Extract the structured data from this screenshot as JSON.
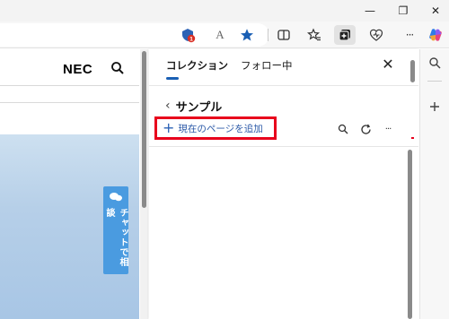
{
  "window": {
    "minimize_glyph": "—",
    "restore_glyph": "❐",
    "close_glyph": "✕"
  },
  "toolbar": {
    "icons": [
      "extension-alert-icon",
      "read-aloud-icon",
      "favorite-star-icon",
      "split-screen-icon",
      "favorites-icon",
      "collections-icon",
      "browser-essentials-icon",
      "more-icon",
      "copilot-icon"
    ],
    "alert_badge": "1",
    "read_aloud_glyph": "A",
    "more_glyph": "···"
  },
  "page": {
    "logo": "NEC",
    "chat_button": "チャットで相談"
  },
  "panel": {
    "tabs": [
      {
        "label": "コレクション",
        "active": true
      },
      {
        "label": "フォロー中",
        "active": false
      }
    ],
    "close_glyph": "✕",
    "back_glyph": "‹",
    "collection_title": "サンプル",
    "add_page_label": "現在のページを追加",
    "add_glyph": "+",
    "more_glyph": "···"
  },
  "sidebar": {
    "icons": [
      "search-icon",
      "add-icon"
    ]
  },
  "colors": {
    "accent_blue": "#2c62b5",
    "highlight_red": "#e8001c",
    "chat_tab": "#4a9be0",
    "star": "#1a5fb4",
    "badge_red": "#d93025"
  }
}
